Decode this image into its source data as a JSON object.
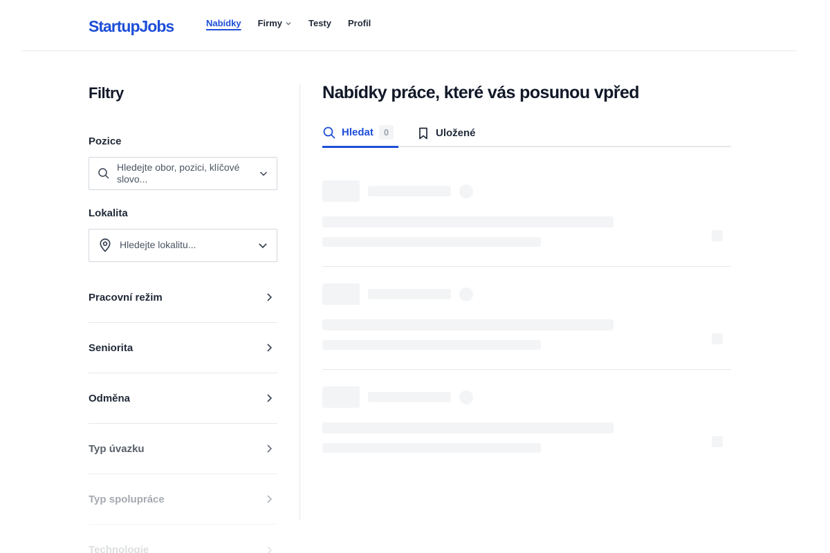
{
  "header": {
    "logo_part1": "Startup",
    "logo_part2": "Jobs",
    "nav": [
      {
        "label": "Nabídky",
        "active": true
      },
      {
        "label": "Firmy",
        "has_dropdown": true
      },
      {
        "label": "Testy"
      },
      {
        "label": "Profil"
      }
    ]
  },
  "sidebar": {
    "title": "Filtry",
    "position": {
      "label": "Pozice",
      "placeholder": "Hledejte obor, pozici, klíčové slovo..."
    },
    "location": {
      "label": "Lokalita",
      "placeholder": "Hledejte lokalitu..."
    },
    "accordions": [
      {
        "label": "Pracovní režim"
      },
      {
        "label": "Seniorita"
      },
      {
        "label": "Odměna"
      },
      {
        "label": "Typ úvazku"
      },
      {
        "label": "Typ spolupráce"
      },
      {
        "label": "Technologie"
      }
    ]
  },
  "main": {
    "title": "Nabídky práce, které vás posunou vpřed",
    "tabs": {
      "search_label": "Hledat",
      "search_count": "0",
      "saved_label": "Uložené"
    }
  },
  "colors": {
    "accent": "#1d4ed8",
    "skeleton": "#f3f4f6",
    "border": "#e5e7eb"
  },
  "icons": [
    "search-icon",
    "chevron-down-icon",
    "location-pin-icon",
    "chevron-right-icon",
    "bookmark-icon"
  ]
}
